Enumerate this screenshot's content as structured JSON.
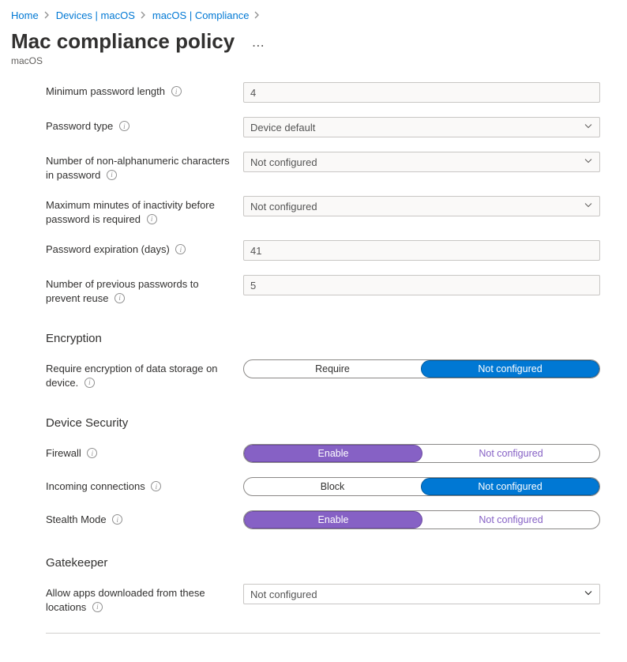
{
  "breadcrumbs": {
    "home": "Home",
    "devices": "Devices | macOS",
    "compliance": "macOS | Compliance"
  },
  "header": {
    "title": "Mac compliance policy",
    "subtitle": "macOS"
  },
  "password": {
    "min_length_label": "Minimum password length",
    "min_length_value": "4",
    "type_label": "Password type",
    "type_value": "Device default",
    "nonalpha_label": "Number of non-alphanumeric characters in password",
    "nonalpha_value": "Not configured",
    "inactivity_label": "Maximum minutes of inactivity before password is required",
    "inactivity_value": "Not configured",
    "expiration_label": "Password expiration (days)",
    "expiration_value": "41",
    "prev_reuse_label": "Number of previous passwords to prevent reuse",
    "prev_reuse_value": "5"
  },
  "encryption": {
    "header": "Encryption",
    "require_label": "Require encryption of data storage on device.",
    "opt_require": "Require",
    "opt_notconf": "Not configured"
  },
  "device_security": {
    "header": "Device Security",
    "firewall_label": "Firewall",
    "firewall_opt_enable": "Enable",
    "firewall_opt_notconf": "Not configured",
    "incoming_label": "Incoming connections",
    "incoming_opt_block": "Block",
    "incoming_opt_notconf": "Not configured",
    "stealth_label": "Stealth Mode",
    "stealth_opt_enable": "Enable",
    "stealth_opt_notconf": "Not configured"
  },
  "gatekeeper": {
    "header": "Gatekeeper",
    "allow_label": "Allow apps downloaded from these locations",
    "allow_value": "Not configured"
  }
}
